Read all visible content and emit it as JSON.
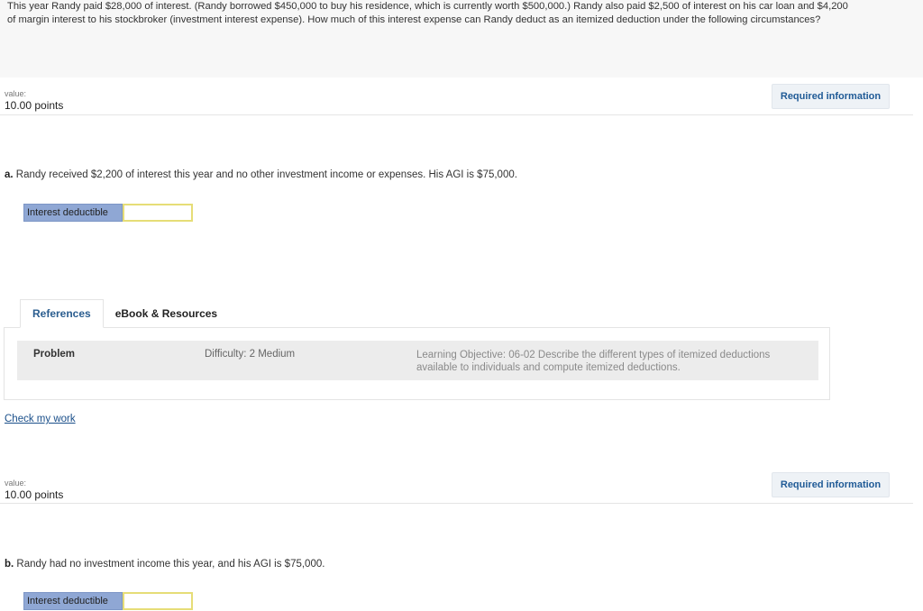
{
  "intro": {
    "line1": "This year Randy paid $28,000 of interest. (Randy borrowed $450,000 to buy his residence, which is currently worth $500,000.) Randy also paid $2,500 of interest on his car loan and $4,200",
    "line2": "of margin interest to his stockbroker (investment interest expense). How much of this interest expense can Randy deduct as an itemized deduction under the following circumstances?"
  },
  "parts": [
    {
      "value_label": "value:",
      "value_points": "10.00 points",
      "required_button": "Required information",
      "question_letter": "a.",
      "question_text": " Randy received $2,200 of interest this year and no other investment income or expenses. His AGI is $75,000.",
      "answer_label": "Interest deductible",
      "answer_value": ""
    },
    {
      "value_label": "value:",
      "value_points": "10.00 points",
      "required_button": "Required information",
      "question_letter": "b.",
      "question_text": " Randy had no investment income this year, and his AGI is $75,000.",
      "answer_label": "Interest deductible",
      "answer_value": ""
    }
  ],
  "tabs": [
    "References",
    "eBook & Resources"
  ],
  "reference": {
    "problem": "Problem",
    "difficulty": "Difficulty: 2 Medium",
    "objective": "Learning Objective: 06-02 Describe the different types of itemized deductions available to individuals and compute itemized deductions."
  },
  "check_my_work": "Check my work"
}
